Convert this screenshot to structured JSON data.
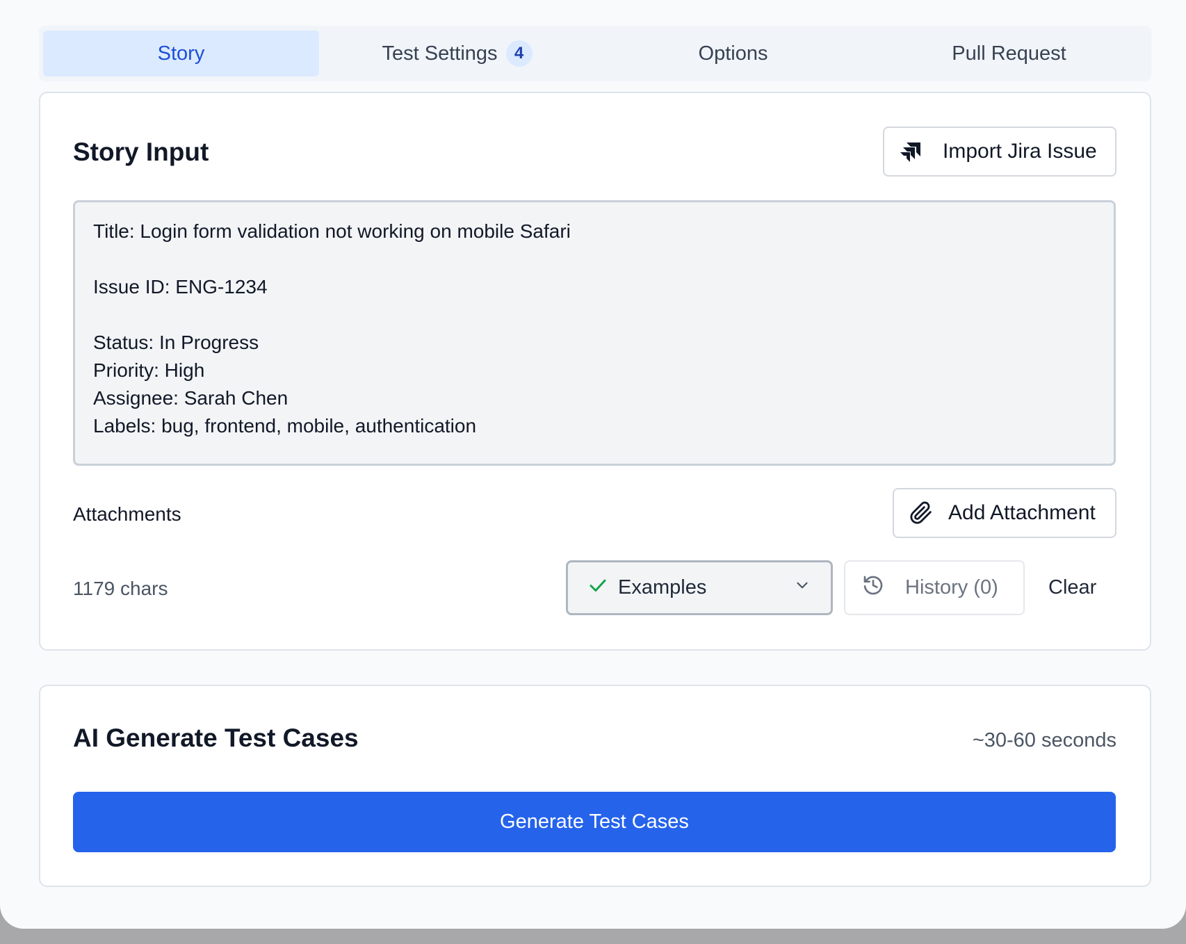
{
  "tabs": [
    {
      "label": "Story",
      "active": true
    },
    {
      "label": "Test Settings",
      "badge": "4",
      "active": false
    },
    {
      "label": "Options",
      "active": false
    },
    {
      "label": "Pull Request",
      "active": false
    }
  ],
  "story": {
    "title": "Story Input",
    "import_button": "Import Jira Issue",
    "content": "Title: Login form validation not working on mobile Safari\n\nIssue ID: ENG-1234\n\nStatus: In Progress\nPriority: High\nAssignee: Sarah Chen\nLabels: bug, frontend, mobile, authentication",
    "attachments_label": "Attachments",
    "add_attachment_button": "Add Attachment",
    "char_count": "1179 chars",
    "examples_label": "Examples",
    "history_label": "History (0)",
    "clear_label": "Clear"
  },
  "ai": {
    "title": "AI Generate Test Cases",
    "eta": "~30-60 seconds",
    "generate_button": "Generate Test Cases"
  },
  "colors": {
    "accent": "#2563eb",
    "active_tab_bg": "#dbeafe",
    "active_tab_text": "#1d4ed8",
    "check": "#16a34a"
  },
  "icons": [
    "jira-icon",
    "paperclip-icon",
    "check-icon",
    "chevron-down-icon",
    "history-icon"
  ]
}
